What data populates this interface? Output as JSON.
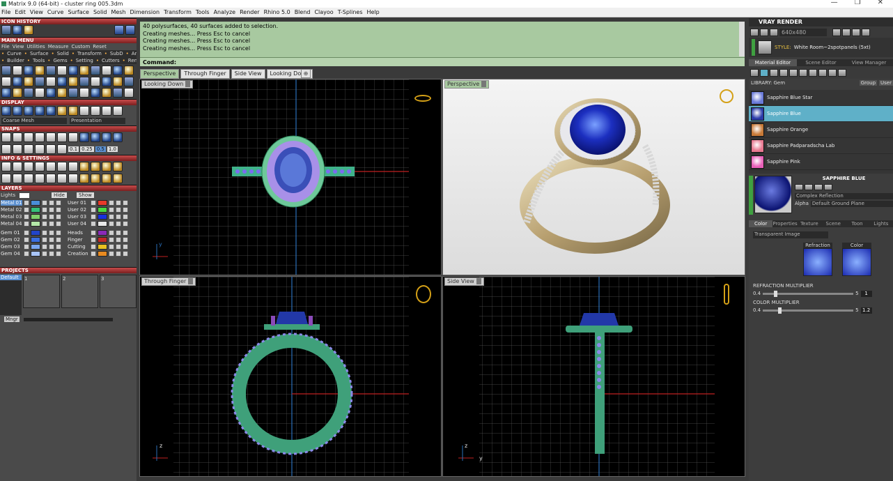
{
  "window": {
    "title": "Matrix 9.0 (64-bit) - cluster ring 005.3dm",
    "minimize": "—",
    "maximize": "❐",
    "close": "✕"
  },
  "menu": [
    "File",
    "Edit",
    "View",
    "Curve",
    "Surface",
    "Solid",
    "Mesh",
    "Dimension",
    "Transform",
    "Tools",
    "Analyze",
    "Render",
    "Rhino 5.0",
    "Blend",
    "Clayoo",
    "T-Splines",
    "Help"
  ],
  "left": {
    "icon_history": "ICON HISTORY",
    "main_menu": "MAIN MENU",
    "main_menu_row1": [
      "File",
      "View",
      "Utilities",
      "Measure",
      "Custom",
      "Reset"
    ],
    "main_menu_row2": [
      "Curve",
      "Surface",
      "Solid",
      "Transform",
      "SubD",
      "Art"
    ],
    "main_menu_row3": [
      "Builder",
      "Tools",
      "Gems",
      "Setting",
      "Cutters",
      "Render"
    ],
    "display": "DISPLAY",
    "display_left": "Coarse Mesh",
    "display_right": "Presentation",
    "snaps": "SNAPS",
    "snap_values": [
      "0.1",
      "0.25",
      "0.5",
      "1.0"
    ],
    "info_settings": "INFO & SETTINGS",
    "layers": "LAYERS",
    "lights": "Lights",
    "hide": "Hide",
    "show": "Show",
    "layers_left": [
      {
        "name": "Metal 01",
        "color": "#4a8ed8"
      },
      {
        "name": "Metal 02",
        "color": "#35c07a"
      },
      {
        "name": "Metal 03",
        "color": "#7fd06a"
      },
      {
        "name": "Metal 04",
        "color": "#b4e8a8"
      },
      {
        "name": "Gem 01",
        "color": "#2245c8"
      },
      {
        "name": "Gem 02",
        "color": "#3a6ee0"
      },
      {
        "name": "Gem 03",
        "color": "#7aa6f0"
      },
      {
        "name": "Gem 04",
        "color": "#a8c4f8"
      }
    ],
    "layers_right": [
      {
        "name": "User 01",
        "color": "#e83a2a"
      },
      {
        "name": "User 02",
        "color": "#48d840"
      },
      {
        "name": "User 03",
        "color": "#1830e0"
      },
      {
        "name": "User 04",
        "color": "#e8e8e8"
      },
      {
        "name": "Heads",
        "color": "#8a2ab8"
      },
      {
        "name": "Finger",
        "color": "#c02828"
      },
      {
        "name": "Cutting",
        "color": "#e8c020"
      },
      {
        "name": "Creation",
        "color": "#e88a20"
      }
    ],
    "projects": "PROJECTS",
    "project_default": "Default",
    "project_slots": [
      "1",
      "2",
      "3"
    ],
    "mngr": "Mngr"
  },
  "command": {
    "lines": [
      "40 polysurfaces, 40 surfaces added to selection.",
      "Creating meshes... Press Esc to cancel",
      "Creating meshes... Press Esc to cancel",
      "Creating meshes... Press Esc to cancel"
    ],
    "prompt": "Command:"
  },
  "viewport_tabs": [
    "Perspective",
    "Through Finger",
    "Side View",
    "Looking Down"
  ],
  "viewports": {
    "top_left": "Looking Down",
    "top_right": "Perspective",
    "bottom_left": "Through Finger",
    "bottom_right": "Side View",
    "axes": {
      "y": "y",
      "z": "z"
    }
  },
  "right": {
    "title": "VRAY RENDER",
    "resolution": "640x480",
    "style_label": "STYLE:",
    "style_value": "White Room~2spotpanels (5xt)",
    "tabs": [
      "Material Editor",
      "Scene Editor",
      "View Manager"
    ],
    "library": "LIBRARY: Gem",
    "group": "Group",
    "user": "User",
    "materials": [
      {
        "name": "Sapphire Blue Star",
        "color": "#6a7ad8"
      },
      {
        "name": "Sapphire Blue",
        "color": "#2a3aa8"
      },
      {
        "name": "Sapphire Orange",
        "color": "#c87a38"
      },
      {
        "name": "Sapphire Padparadscha Lab",
        "color": "#e87890"
      },
      {
        "name": "Sapphire Pink",
        "color": "#e860b8"
      }
    ],
    "selected_material": "SAPPHIRE BLUE",
    "complex_reflection": "Complex Reflection",
    "alpha": "Alpha",
    "ground_plane": "Default Ground Plane",
    "prop_tabs": [
      "Color",
      "Properties",
      "Texture",
      "Scene",
      "Toon",
      "Lights"
    ],
    "transparent_image": "Transparent Image",
    "refraction_label": "Refraction",
    "color_label": "Color",
    "refraction_multiplier": "REFRACTION MULTIPLIER",
    "refraction_min": "0.4",
    "refraction_max": "5",
    "refraction_value": "1",
    "color_multiplier": "COLOR MULTIPLIER",
    "color_min": "0.4",
    "color_max": "5",
    "color_value": "1.2"
  }
}
